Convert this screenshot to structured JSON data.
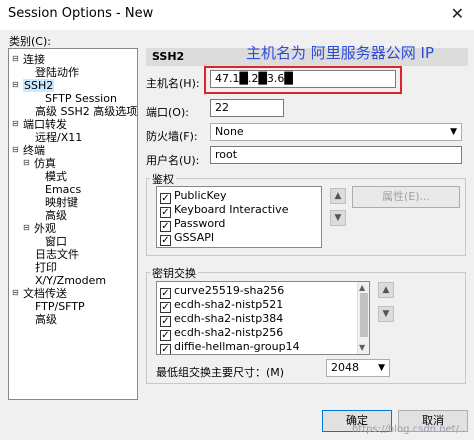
{
  "window": {
    "title": "Session Options - New",
    "close_glyph": "✕"
  },
  "category_label": "类别(C):",
  "tree": [
    {
      "label": "连接",
      "expander": "⊟"
    },
    {
      "label": "登陆动作"
    },
    {
      "label": "SSH2",
      "expander": "⊟",
      "selected": true
    },
    {
      "label": "SFTP Session"
    },
    {
      "label": "高级 SSH2 高级选项"
    },
    {
      "label": "端口转发",
      "expander": "⊟"
    },
    {
      "label": "远程/X11"
    },
    {
      "label": "终端",
      "expander": "⊟"
    },
    {
      "label": "仿真",
      "expander": "⊟"
    },
    {
      "label": "模式"
    },
    {
      "label": "Emacs"
    },
    {
      "label": "映射键"
    },
    {
      "label": "高级"
    },
    {
      "label": "外观",
      "expander": "⊟"
    },
    {
      "label": "窗口"
    },
    {
      "label": "日志文件"
    },
    {
      "label": "打印"
    },
    {
      "label": "X/Y/Zmodem"
    },
    {
      "label": "文档传送",
      "expander": "⊟"
    },
    {
      "label": "FTP/SFTP"
    },
    {
      "label": "高级"
    }
  ],
  "section_title": "SSH2",
  "annotation": "主机名为 阿里服务器公网 IP",
  "hostname": {
    "label": "主机名(H):",
    "value": "47.1█.2█3.6█"
  },
  "port": {
    "label": "端口(O):",
    "value": "22"
  },
  "firewall": {
    "label": "防火墙(F):",
    "value": "None"
  },
  "username": {
    "label": "用户名(U):",
    "value": "root"
  },
  "auth": {
    "title": "鉴权",
    "items": [
      {
        "label": "PublicKey",
        "checked": true
      },
      {
        "label": "Keyboard Interactive",
        "checked": true
      },
      {
        "label": "Password",
        "checked": true
      },
      {
        "label": "GSSAPI",
        "checked": true
      }
    ],
    "up_glyph": "▲",
    "down_glyph": "▼",
    "properties_button": "属性(E)..."
  },
  "kex": {
    "title": "密钥交换",
    "items": [
      {
        "label": "curve25519-sha256",
        "checked": true
      },
      {
        "label": "ecdh-sha2-nistp521",
        "checked": true
      },
      {
        "label": "ecdh-sha2-nistp384",
        "checked": true
      },
      {
        "label": "ecdh-sha2-nistp256",
        "checked": true
      },
      {
        "label": "diffie-hellman-group14",
        "checked": true
      }
    ],
    "up_glyph": "▲",
    "down_glyph": "▼"
  },
  "min_key": {
    "label": "最低组交换主要尺寸：(M)",
    "value": "2048"
  },
  "buttons": {
    "ok": "确定",
    "cancel": "取消"
  },
  "watermark": "https://blog.csdn.net/..."
}
